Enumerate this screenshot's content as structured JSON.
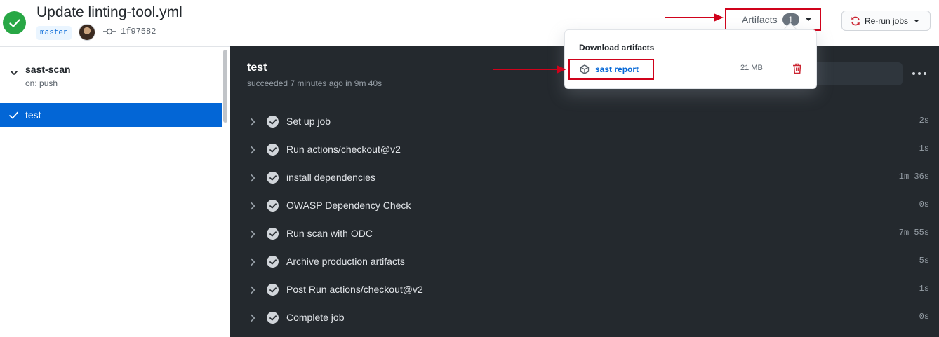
{
  "header": {
    "title": "Update linting-tool.yml",
    "branch": "master",
    "commit": "1f97582",
    "artifacts_label": "Artifacts",
    "artifacts_count": "1",
    "rerun_label": "Re-run jobs"
  },
  "sidebar": {
    "workflow_name": "sast-scan",
    "workflow_trigger": "on: push",
    "jobs": [
      {
        "label": "test",
        "status": "success"
      }
    ]
  },
  "job": {
    "title": "test",
    "subtitle": "succeeded 7 minutes ago in 9m 40s",
    "steps": [
      {
        "name": "Set up job",
        "time": "2s"
      },
      {
        "name": "Run actions/checkout@v2",
        "time": "1s"
      },
      {
        "name": "install dependencies",
        "time": "1m 36s"
      },
      {
        "name": "OWASP Dependency Check",
        "time": "0s"
      },
      {
        "name": "Run scan with ODC",
        "time": "7m 55s"
      },
      {
        "name": "Archive production artifacts",
        "time": "5s"
      },
      {
        "name": "Post Run actions/checkout@v2",
        "time": "1s"
      },
      {
        "name": "Complete job",
        "time": "0s"
      }
    ]
  },
  "dropdown": {
    "header": "Download artifacts",
    "artifacts": [
      {
        "name": "sast report",
        "size": "21 MB"
      }
    ]
  },
  "colors": {
    "success": "#28a745",
    "accent": "#0366d6",
    "annotation": "#d0021b",
    "panel": "#24292e"
  },
  "icons": [
    "check-circle-icon",
    "commit-icon",
    "sync-icon",
    "chevron-down-icon",
    "chevron-right-icon",
    "check-icon",
    "kebab-icon",
    "package-icon",
    "trash-icon",
    "arrow-right-icon"
  ]
}
